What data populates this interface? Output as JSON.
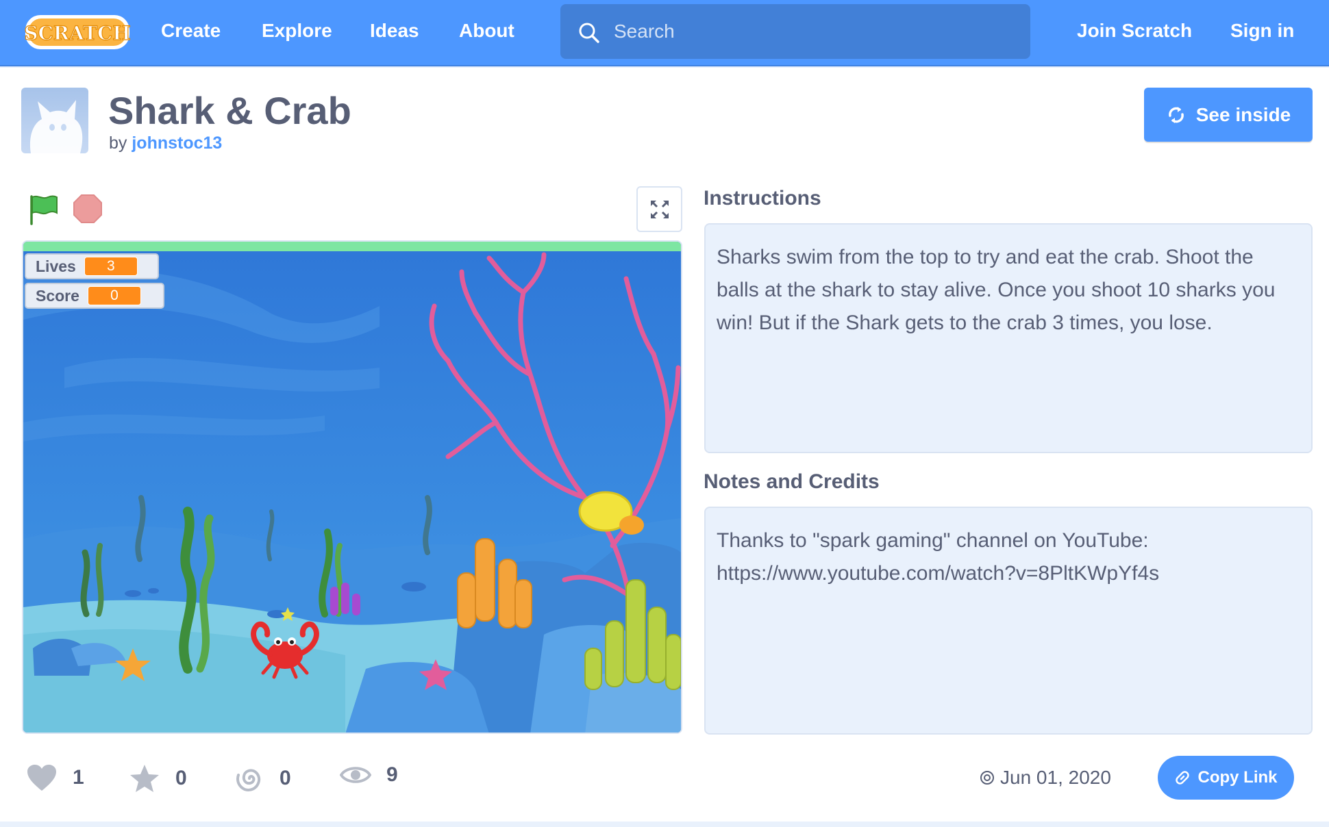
{
  "nav": {
    "logo_text": "SCRATCH",
    "links": [
      "Create",
      "Explore",
      "Ideas",
      "About"
    ],
    "search_placeholder": "Search",
    "join": "Join Scratch",
    "signin": "Sign in"
  },
  "project": {
    "title": "Shark & Crab",
    "by_prefix": "by",
    "author": "johnstoc13",
    "see_inside": "See inside"
  },
  "stage": {
    "monitors": [
      {
        "label": "Lives",
        "value": "3"
      },
      {
        "label": "Score",
        "value": "0"
      }
    ]
  },
  "instructions": {
    "title": "Instructions",
    "text": "Sharks swim from the top to try and eat the crab. Shoot the balls at the shark to stay alive. Once you shoot 10 sharks you win! But if the Shark gets to the crab 3 times, you lose."
  },
  "notes": {
    "title": "Notes and Credits",
    "line1": "Thanks to \"spark gaming\" channel on YouTube:",
    "line2": "https://www.youtube.com/watch?v=8PltKWpYf4s"
  },
  "stats": {
    "loves": "1",
    "favorites": "0",
    "remixes": "0",
    "views": "9"
  },
  "share_date": "Jun 01, 2020",
  "copy_link": "Copy Link",
  "colors": {
    "brand": "#4d97ff",
    "text": "#575e75",
    "panel_bg": "#e9f1fc",
    "monitor_value": "#ff8c1a"
  }
}
